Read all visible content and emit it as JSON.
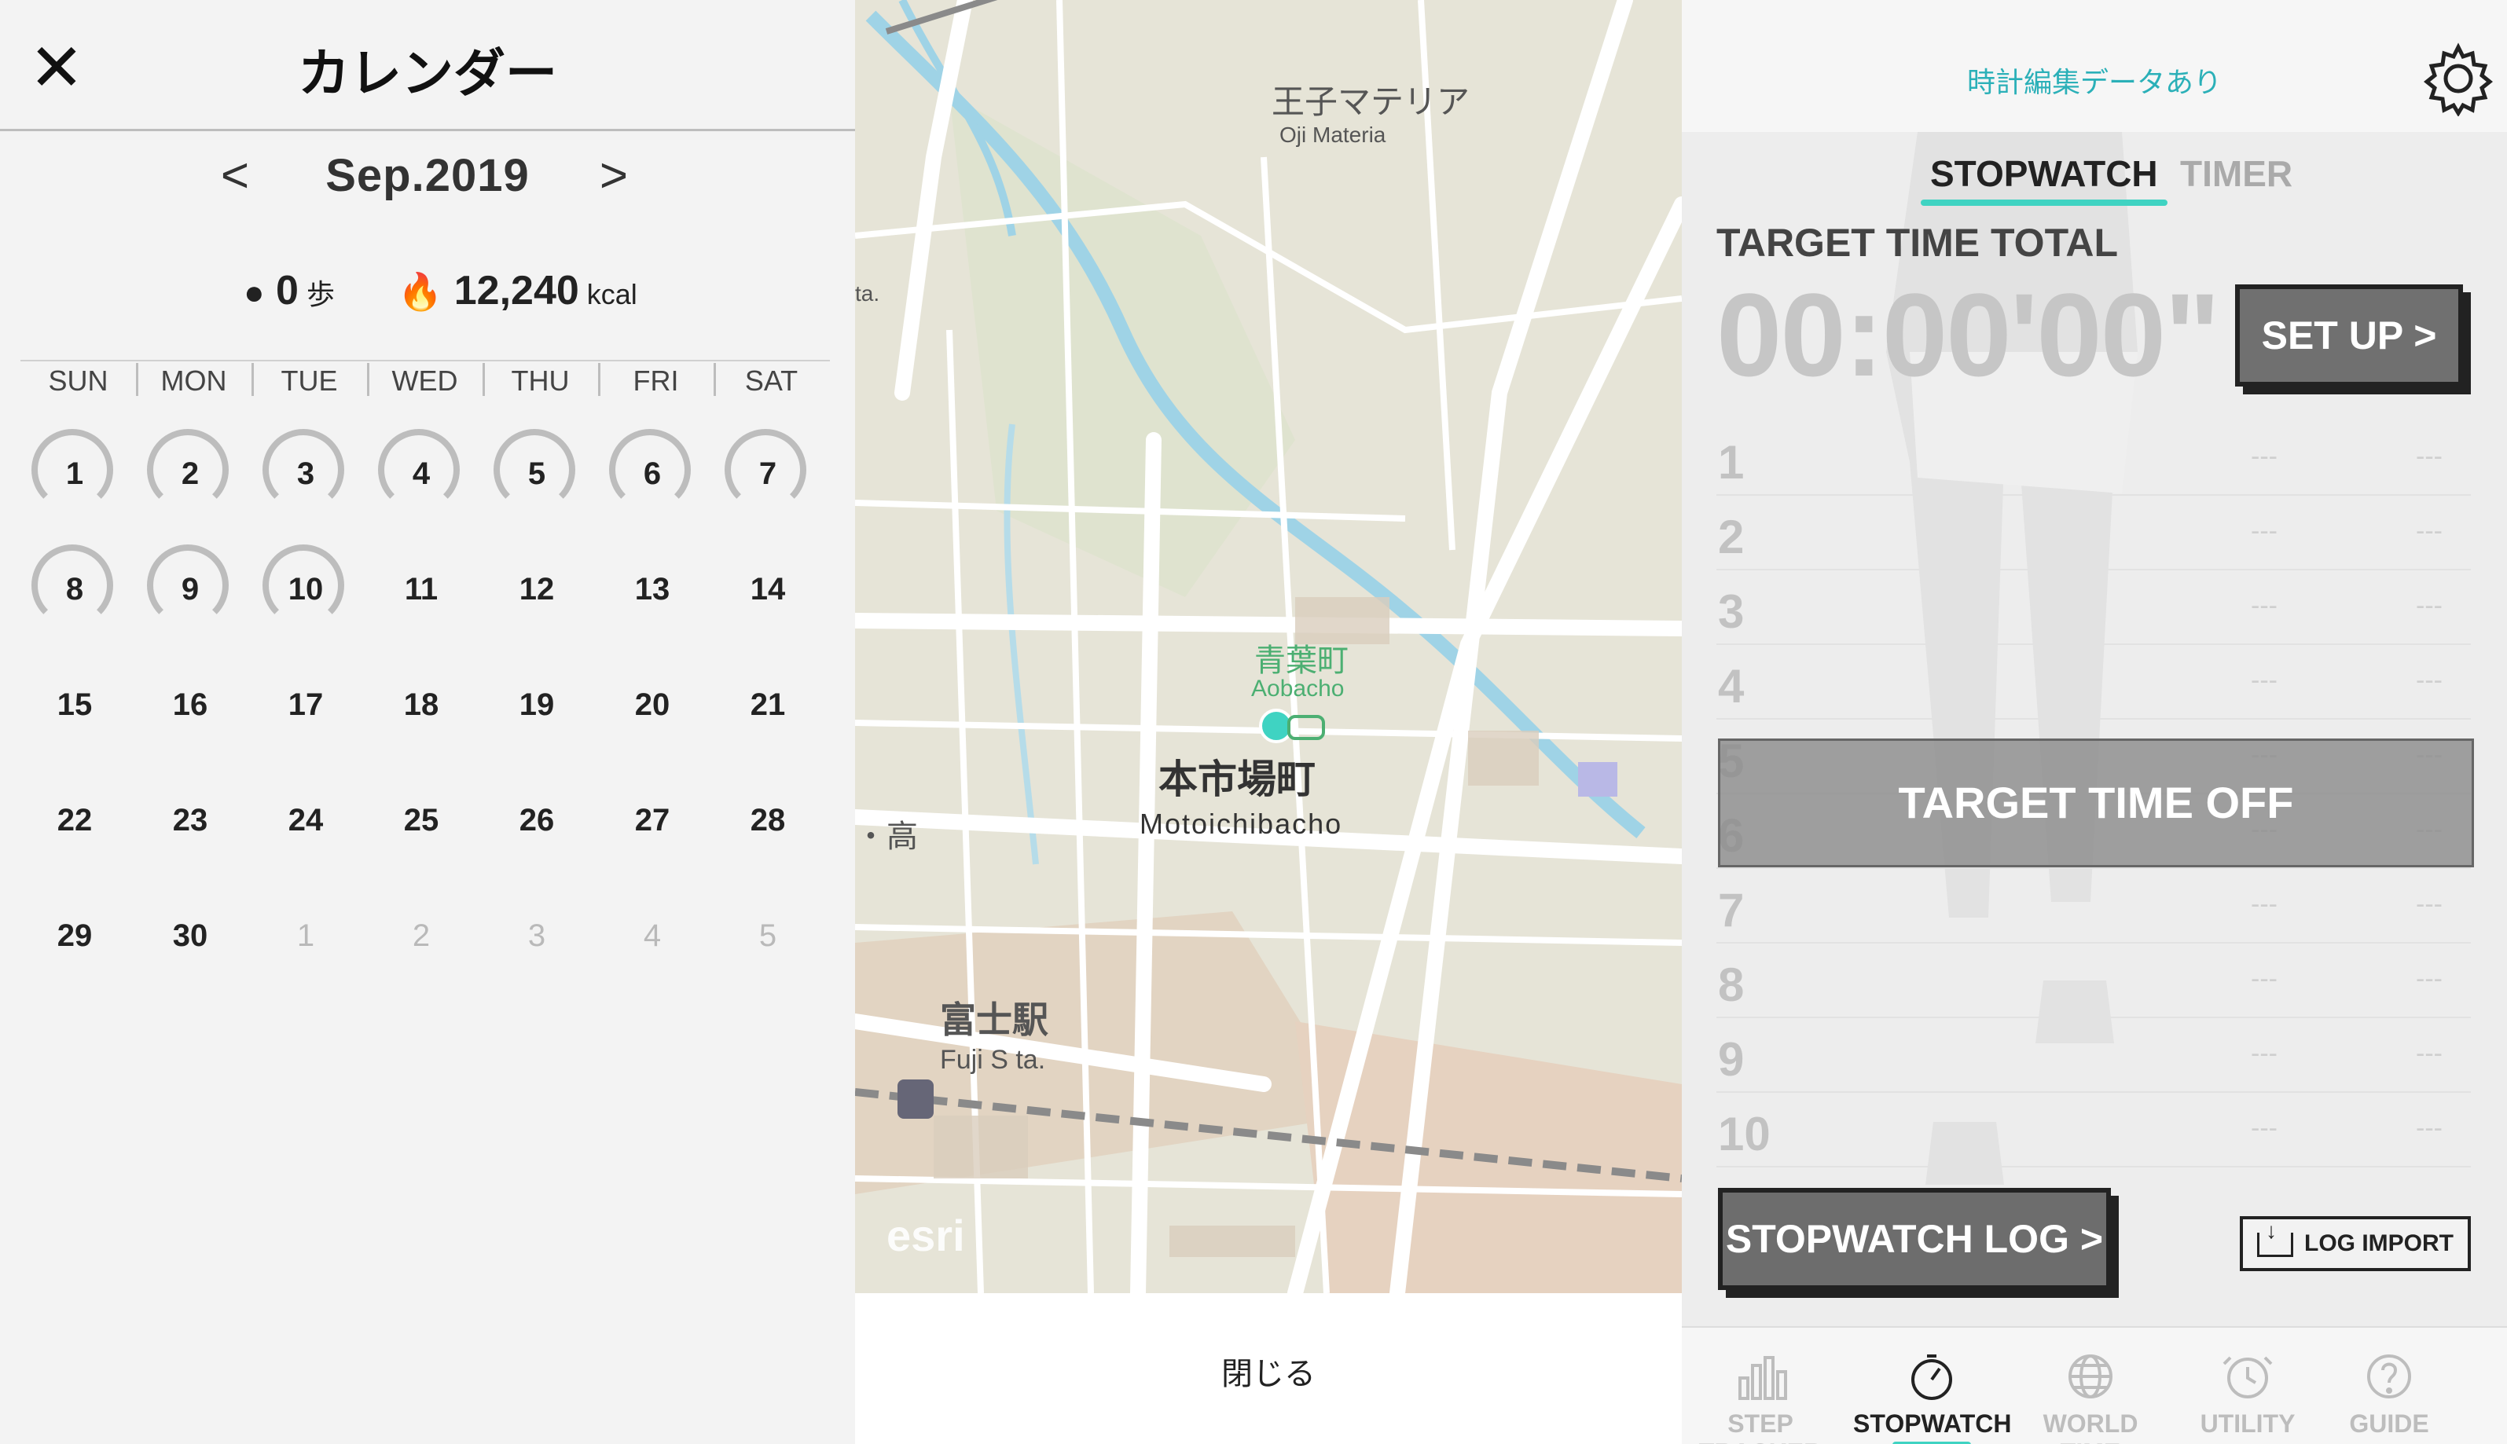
{
  "calendar": {
    "close_icon": "close-icon",
    "title": "カレンダー",
    "month": "Sep.2019",
    "prev_icon": "chevron-left-icon",
    "next_icon": "chevron-right-icon",
    "steps_value": "0",
    "steps_unit": "歩",
    "kcal_value": "12,240",
    "kcal_unit": "kcal",
    "weekdays": [
      "SUN",
      "MON",
      "TUE",
      "WED",
      "THU",
      "FRI",
      "SAT"
    ],
    "weeks": [
      [
        "1",
        "2",
        "3",
        "4",
        "5",
        "6",
        "7"
      ],
      [
        "8",
        "9",
        "10",
        "11",
        "12",
        "13",
        "14"
      ],
      [
        "15",
        "16",
        "17",
        "18",
        "19",
        "20",
        "21"
      ],
      [
        "22",
        "23",
        "24",
        "25",
        "26",
        "27",
        "28"
      ],
      [
        "29",
        "30",
        "1",
        "2",
        "3",
        "4",
        "5"
      ]
    ],
    "ringed_days": [
      "1",
      "2",
      "3",
      "4",
      "5",
      "6",
      "7",
      "8",
      "9",
      "10"
    ],
    "muted_from_week5_index": 2
  },
  "map": {
    "labels": {
      "oji_jp": "王子マテリア",
      "oji_en": "Oji Materia",
      "aobacho_jp": "青葉町",
      "aobacho_en": "Aobacho",
      "motoichiba_jp": "本市場町",
      "motoichiba_en": "Motoichibacho",
      "fuji_jp": "富士駅",
      "fuji_en": "Fuji S ta.",
      "edge_ta": "ta.",
      "edge_high": "・高",
      "esri": "esri"
    },
    "close_label": "閉じる",
    "location_color": "#3fd3c2"
  },
  "stopwatch": {
    "notice": "時計編集データあり",
    "tabs": [
      "STOPWATCH",
      "TIMER"
    ],
    "target_label": "TARGET TIME TOTAL",
    "target_time": "00:00'00\"",
    "setup_label": "SET UP >",
    "laps": [
      {
        "n": "1",
        "a": "---",
        "b": "---"
      },
      {
        "n": "2",
        "a": "---",
        "b": "---"
      },
      {
        "n": "3",
        "a": "---",
        "b": "---"
      },
      {
        "n": "4",
        "a": "---",
        "b": "---"
      },
      {
        "n": "5",
        "a": "---",
        "b": "---"
      },
      {
        "n": "6",
        "a": "---",
        "b": "---"
      },
      {
        "n": "7",
        "a": "---",
        "b": "---"
      },
      {
        "n": "8",
        "a": "---",
        "b": "---"
      },
      {
        "n": "9",
        "a": "---",
        "b": "---"
      },
      {
        "n": "10",
        "a": "---",
        "b": "---"
      }
    ],
    "target_off": "TARGET TIME OFF",
    "log_label": "STOPWATCH LOG >",
    "import_label": "LOG IMPORT",
    "accent": "#3fd3c2"
  },
  "bottom_nav": [
    {
      "label": "STEP TRACKER",
      "icon": "bar-chart-icon",
      "active": false
    },
    {
      "label": "STOPWATCH",
      "icon": "stopwatch-icon",
      "active": true
    },
    {
      "label": "WORLD TIME",
      "icon": "globe-icon",
      "active": false
    },
    {
      "label": "UTILITY",
      "icon": "alarm-clock-icon",
      "active": false
    },
    {
      "label": "GUIDE",
      "icon": "help-icon",
      "active": false
    }
  ]
}
